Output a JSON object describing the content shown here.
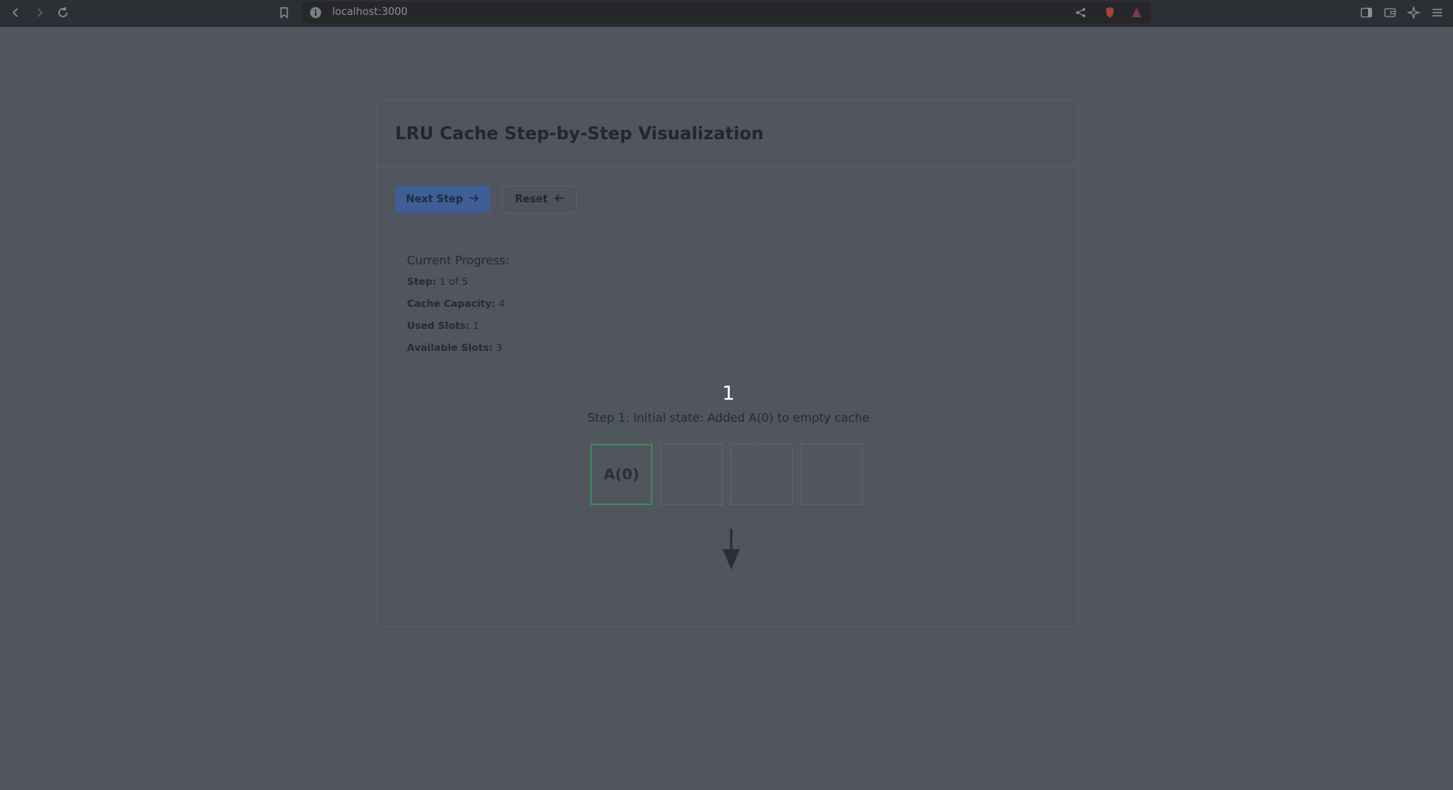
{
  "browser": {
    "url": "localhost:3000"
  },
  "page": {
    "title": "LRU Cache Step-by-Step Visualization"
  },
  "controls": {
    "next_label": "Next Step",
    "reset_label": "Reset"
  },
  "progress": {
    "title": "Current Progress:",
    "step_label": "Step:",
    "step_value": "1 of 5",
    "capacity_label": "Cache Capacity:",
    "capacity_value": "4",
    "used_label": "Used Slots:",
    "used_value": "1",
    "available_label": "Available Slots:",
    "available_value": "3"
  },
  "visualization": {
    "step_number": "1",
    "description": "Step 1: Initial state: Added A(0) to empty cache",
    "new_entry_badge": "New Entry",
    "slots": [
      "A(0)",
      "",
      "",
      ""
    ]
  },
  "colors": {
    "background": "#505560",
    "primary_button": "#3f5e95",
    "filled_slot_border": "#3c8a5e"
  }
}
